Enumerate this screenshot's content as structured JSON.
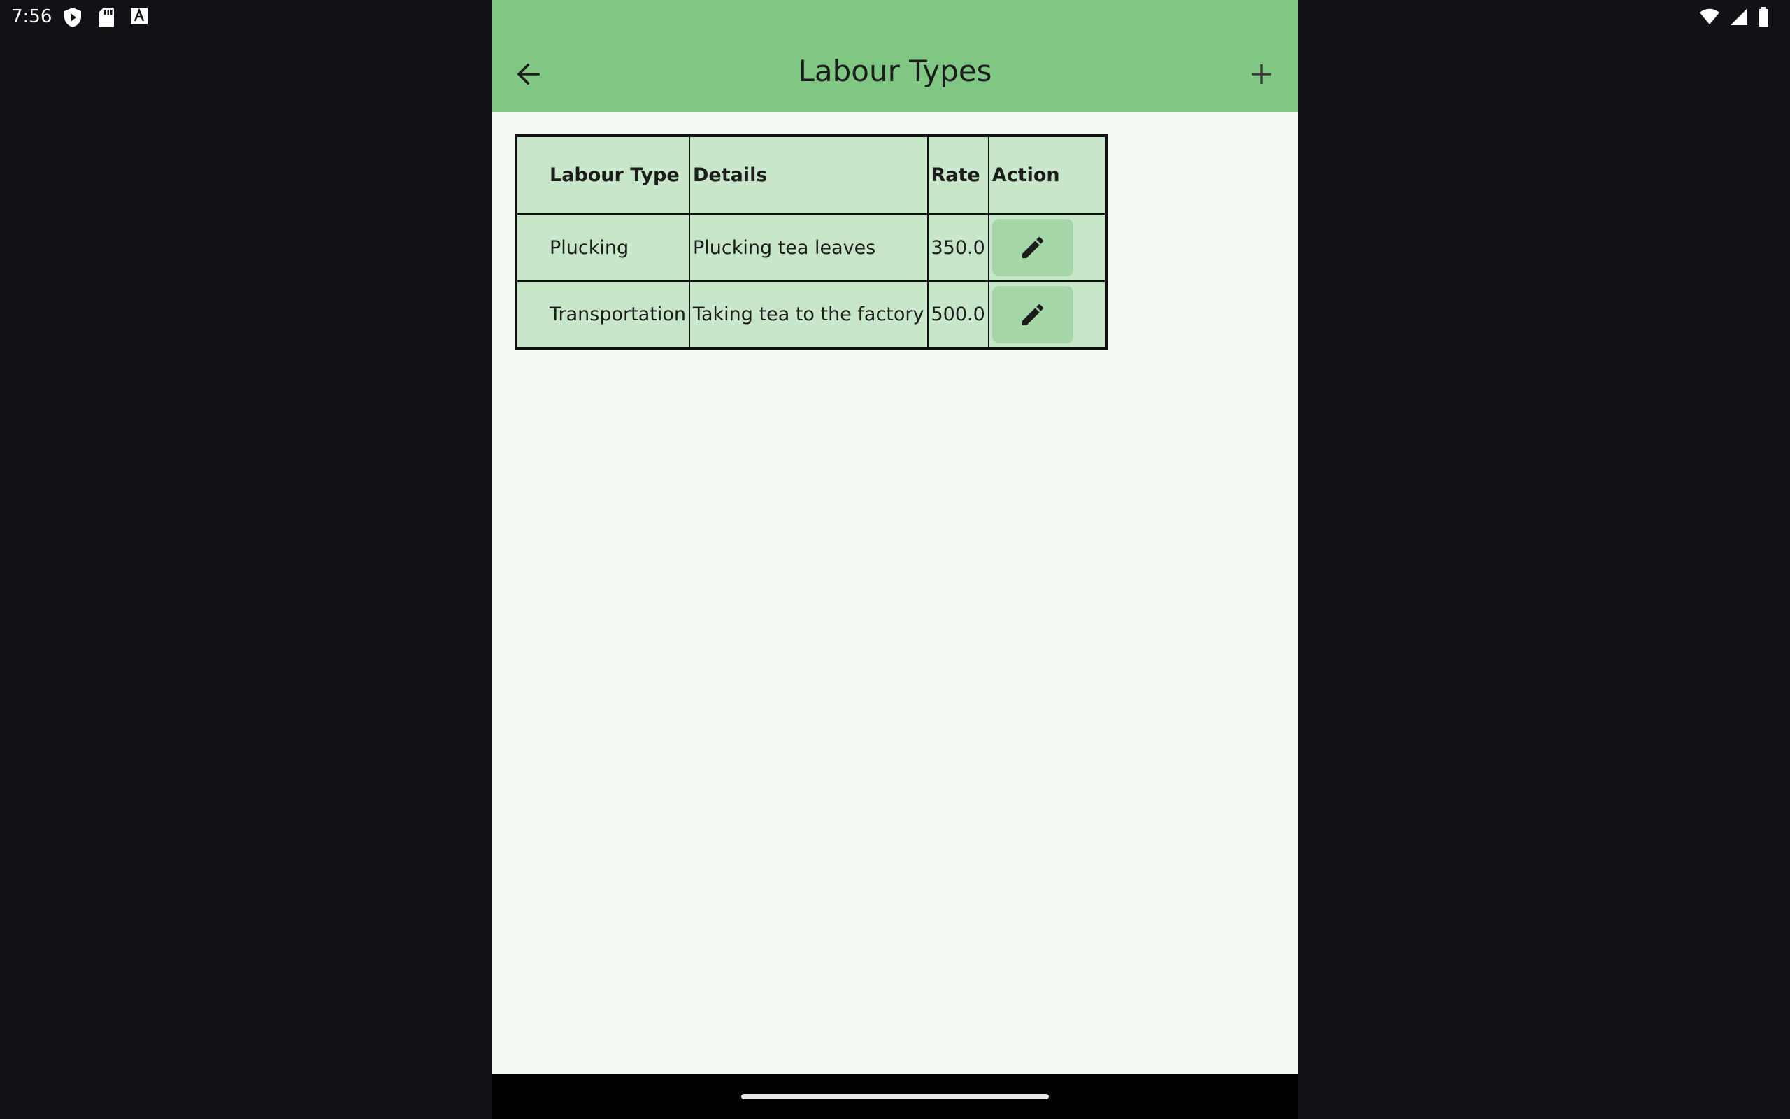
{
  "status_bar": {
    "time": "7:56",
    "left_icons": [
      "shield-play-icon",
      "sd-card-icon",
      "font-a-icon"
    ],
    "right_icons": [
      "wifi-icon",
      "signal-icon",
      "battery-icon"
    ]
  },
  "app_bar": {
    "title": "Labour Types",
    "back_icon": "arrow-left-icon",
    "add_icon": "plus-icon",
    "color": "#81c784"
  },
  "table": {
    "columns": [
      "Labour Type",
      "Details",
      "Rate",
      "Action"
    ],
    "rows": [
      {
        "labour_type": "Plucking",
        "details": "Plucking tea leaves",
        "rate": "350.0",
        "action_icon": "pencil-icon"
      },
      {
        "labour_type": "Transportation",
        "details": "Taking tea to the factory",
        "rate": "500.0",
        "action_icon": "pencil-icon"
      }
    ],
    "background": "#c8e6c9",
    "button_color": "#a5d6a7"
  },
  "colors": {
    "page_background": "#f5faf2",
    "outer_background": "#101216"
  }
}
